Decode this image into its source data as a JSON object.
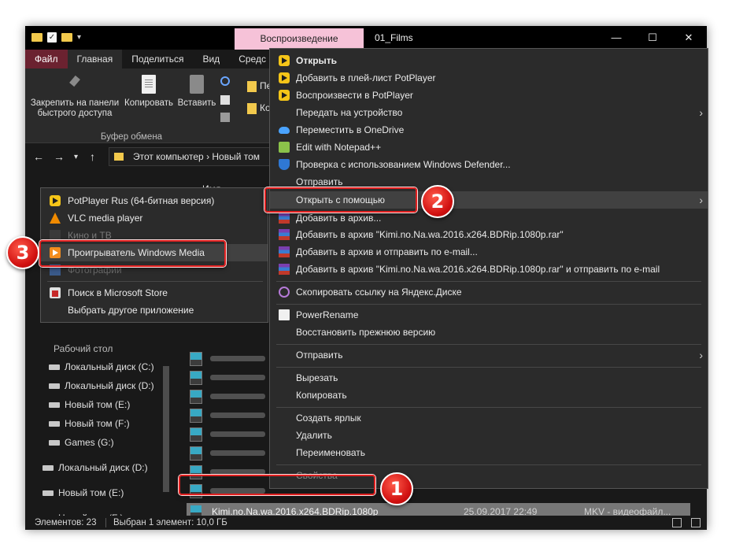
{
  "window": {
    "title": "01_Films",
    "context_tab": "Воспроизведение",
    "controls": {
      "minimize": "—",
      "maximize": "☐",
      "close": "✕"
    }
  },
  "ribbon": {
    "tabs": [
      "Файл",
      "Главная",
      "Поделиться",
      "Вид",
      "Средс"
    ],
    "buttons": {
      "pin": "Закрепить на панели быстрого доступа",
      "copy": "Копировать",
      "paste": "Вставить",
      "move_short": "Пе",
      "copy_short": "Ко"
    },
    "group_label": "Буфер обмена"
  },
  "address": {
    "path": "Этот компьютер  ›  Новый том"
  },
  "navpane": {
    "items": [
      "Рабочий стол",
      "Локальный диск (C:)",
      "Локальный диск (D:)",
      "Новый том (E:)",
      "Новый том (F:)",
      "Games (G:)",
      "Локальный диск (D:)",
      "Новый том (E:)",
      "Новый том (F:)"
    ]
  },
  "filelist": {
    "column_name": "Имя",
    "selected_file": {
      "name": "Kimi.no.Na.wa.2016.x264.BDRip.1080p",
      "date": "25.09.2017 22:49",
      "type": "MKV - видеофайл..."
    },
    "mkv_label": "MKV"
  },
  "status": {
    "count": "Элементов: 23",
    "selection": "Выбран 1 элемент: 10,0 ГБ"
  },
  "context_menu": {
    "items": [
      "Открыть",
      "Добавить в плей-лист PotPlayer",
      "Воспроизвести в PotPlayer",
      "Передать на устройство",
      "Переместить в OneDrive",
      "Edit with Notepad++",
      "Проверка с использованием Windows Defender...",
      "Отправить",
      "Открыть с помощью",
      "Добавить в архив...",
      "Добавить в архив \"Kimi.no.Na.wa.2016.x264.BDRip.1080p.rar\"",
      "Добавить в архив и отправить по e-mail...",
      "Добавить в архив \"Kimi.no.Na.wa.2016.x264.BDRip.1080p.rar\" и отправить по e-mail",
      "Скопировать ссылку на Яндекс.Диске",
      "PowerRename",
      "Восстановить прежнюю версию",
      "Отправить",
      "Вырезать",
      "Копировать",
      "Создать ярлык",
      "Удалить",
      "Переименовать",
      "Свойства"
    ],
    "arrow": "›"
  },
  "submenu": {
    "items": [
      "PotPlayer Rus (64-битная версия)",
      "VLC media player",
      "Кино и ТВ",
      "Проигрыватель Windows Media",
      "Фотографии",
      "Поиск в Microsoft Store",
      "Выбрать другое приложение"
    ]
  },
  "badges": [
    "1",
    "2",
    "3"
  ]
}
